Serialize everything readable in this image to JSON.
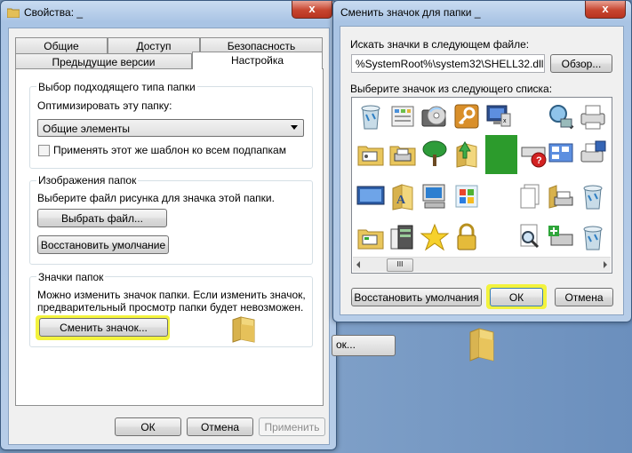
{
  "properties": {
    "title": "Свойства: _",
    "close_label": "x",
    "tabs_top": [
      "Общие",
      "Доступ",
      "Безопасность"
    ],
    "tabs_bottom": [
      "Предыдущие версии",
      "Настройка"
    ],
    "folder_type": {
      "group": "Выбор подходящего типа папки",
      "optimize_label": "Оптимизировать эту папку:",
      "combo_value": "Общие элементы",
      "apply_template": "Применять этот же шаблон ко всем подпапкам"
    },
    "folder_images": {
      "group": "Изображения папок",
      "desc": "Выберите файл рисунка для значка этой папки.",
      "choose_file": "Выбрать файл...",
      "restore": "Восстановить умолчание"
    },
    "folder_icons": {
      "group": "Значки папок",
      "desc_line1": "Можно изменить значок папки. Если изменить значок,",
      "desc_line2": "предварительный просмотр папки будет невозможен.",
      "change_icon": "Сменить значок..."
    },
    "ok": "ОК",
    "cancel": "Отмена",
    "apply": "Применить"
  },
  "change_icon_dialog": {
    "title": "Сменить значок для папки _",
    "close_label": "x",
    "search_label": "Искать значки в следующем файле:",
    "file_path": "%SystemRoot%\\system32\\SHELL32.dll",
    "browse": "Обзор...",
    "list_label": "Выберите значок из следующего списка:",
    "scroll_thumb": "III",
    "restore_defaults": "Восстановить умолчания",
    "ok": "ОК",
    "cancel": "Отмена",
    "icons": [
      "recycle-bin-empty",
      "control-panel",
      "cd-drive",
      "key",
      "computer-monitor",
      "blank",
      "blank",
      "magnifier-network",
      "printer-fax",
      "folder-settings",
      "folder-printer",
      "tree",
      "folder-arrow",
      "green-square",
      "drive-error",
      "network-computers",
      "printer-save",
      "monitor",
      "folder-document",
      "computer-user",
      "windows-update",
      "blank",
      "documents",
      "folder-printer-2",
      "recycle-bin-full",
      "folder-settings-2",
      "server",
      "star",
      "padlock",
      "blank",
      "magnifier-page",
      "network-add",
      "recycle-bin"
    ]
  },
  "background_window": {
    "button_label": "ок..."
  }
}
